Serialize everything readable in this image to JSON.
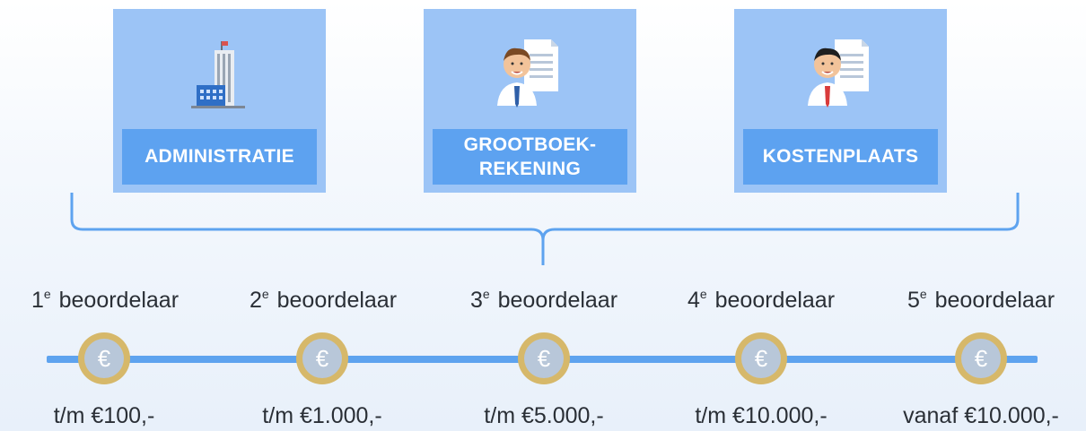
{
  "cards": [
    {
      "label": "ADMINISTRATIE",
      "icon": "building-icon"
    },
    {
      "label": "GROOTBOEK-\nREKENING",
      "icon": "person-document-icon"
    },
    {
      "label": "KOSTENPLAATS",
      "icon": "person-document-icon"
    }
  ],
  "raters": [
    {
      "ordinal": "1",
      "suffix": "e",
      "text": " beoordelaar",
      "amount": "t/m €100,-"
    },
    {
      "ordinal": "2",
      "suffix": "e",
      "text": " beoordelaar",
      "amount": "t/m €1.000,-"
    },
    {
      "ordinal": "3",
      "suffix": "e",
      "text": " beoordelaar",
      "amount": "t/m €5.000,-"
    },
    {
      "ordinal": "4",
      "suffix": "e",
      "text": " beoordelaar",
      "amount": "t/m €10.000,-"
    },
    {
      "ordinal": "5",
      "suffix": "e",
      "text": " beoordelaar",
      "amount": "vanaf €10.000,-"
    }
  ],
  "coin_symbol": "€",
  "colors": {
    "card": "#9cc4f6",
    "label": "#5da2f0",
    "line": "#5ea3ef",
    "coin_rim": "#d6b86a",
    "coin_inner": "#b8c7d9"
  }
}
